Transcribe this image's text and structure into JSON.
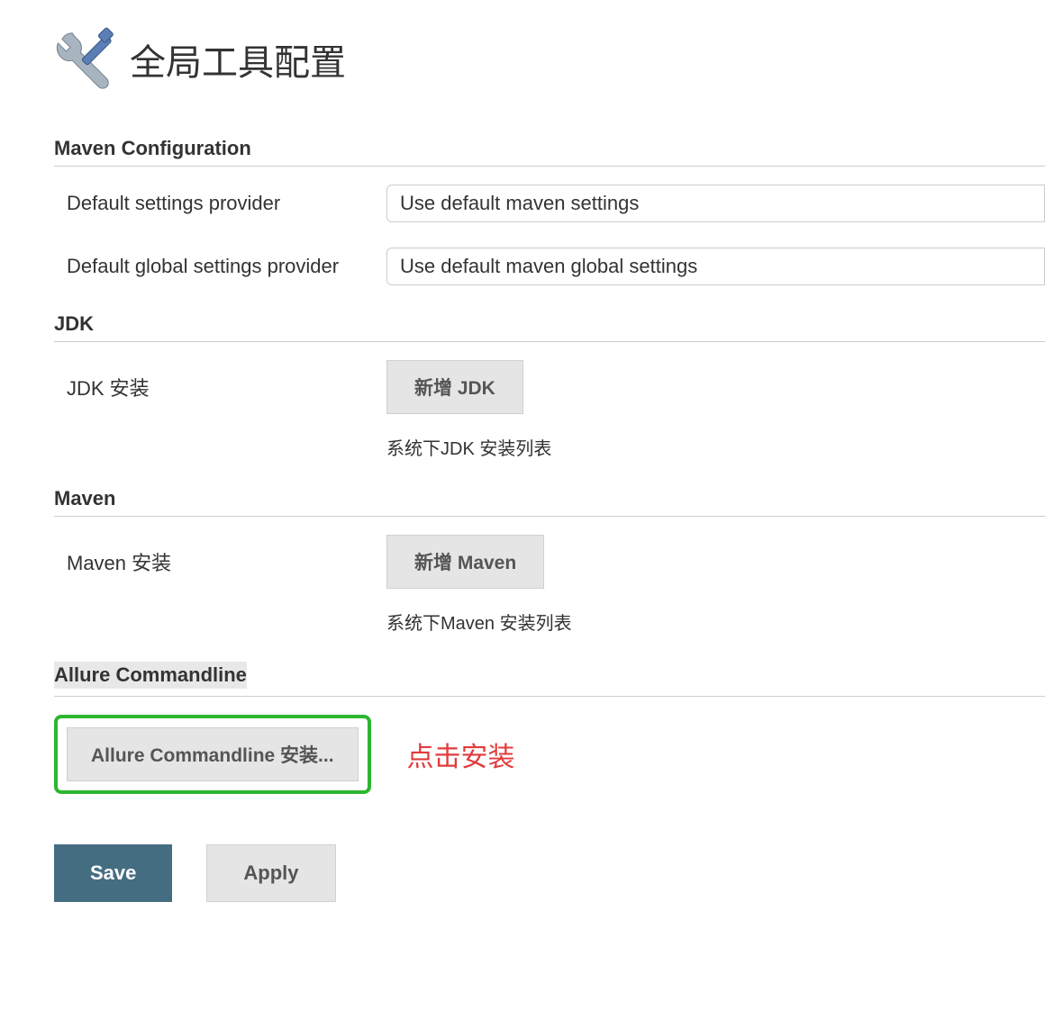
{
  "header": {
    "title": "全局工具配置"
  },
  "sections": {
    "maven_config": {
      "title": "Maven Configuration",
      "default_settings_label": "Default settings provider",
      "default_settings_value": "Use default maven settings",
      "default_global_label": "Default global settings provider",
      "default_global_value": "Use default maven global settings"
    },
    "jdk": {
      "title": "JDK",
      "install_label": "JDK 安装",
      "button_label": "新增 JDK",
      "help_text": "系统下JDK 安装列表"
    },
    "maven": {
      "title": "Maven",
      "install_label": "Maven 安装",
      "button_label": "新增 Maven",
      "help_text": "系统下Maven 安装列表"
    },
    "allure": {
      "title": "Allure Commandline",
      "button_label": "Allure Commandline 安装...",
      "annotation": "点击安装"
    }
  },
  "footer": {
    "save_label": "Save",
    "apply_label": "Apply"
  }
}
